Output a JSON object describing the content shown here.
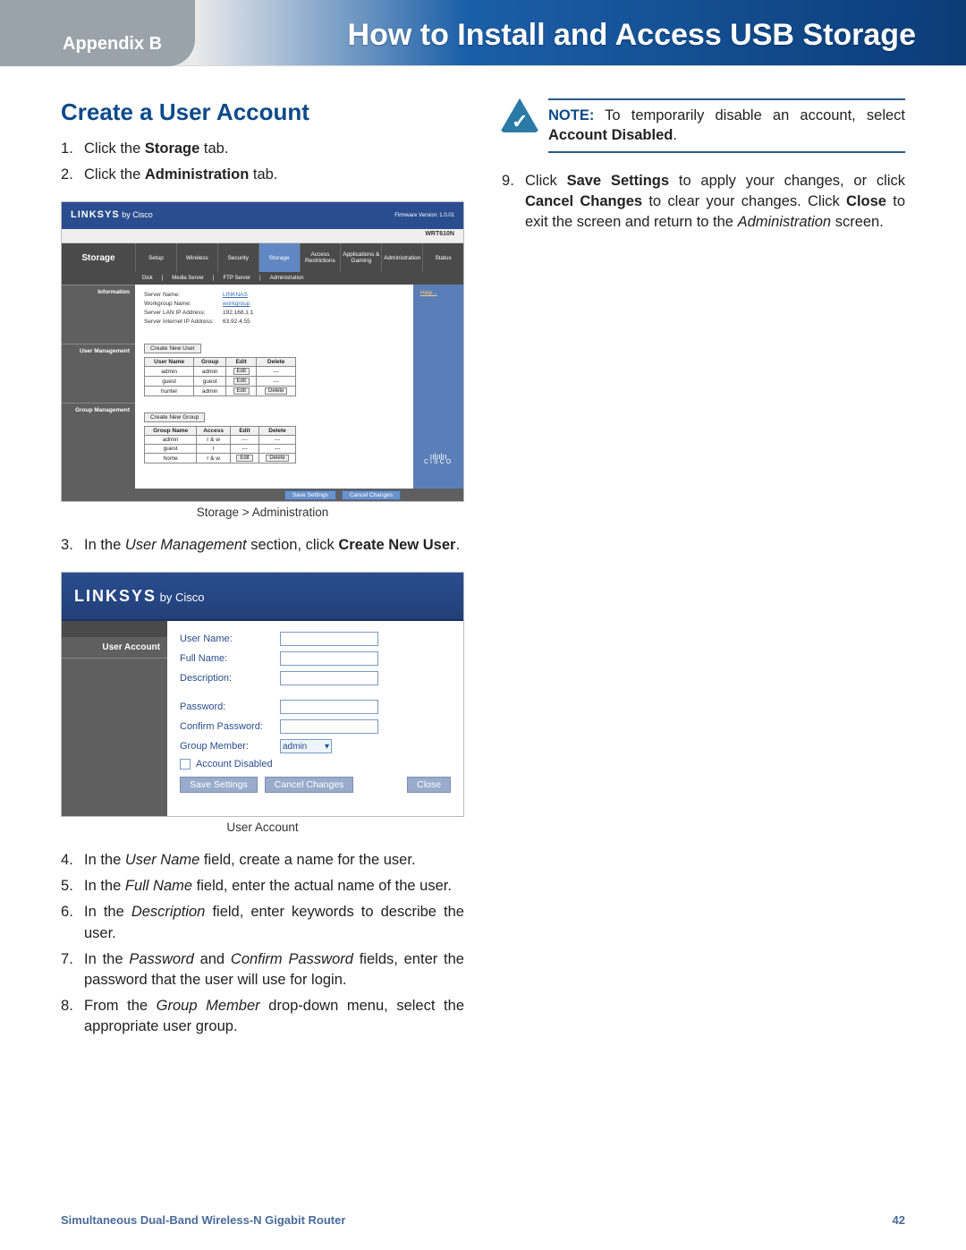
{
  "header": {
    "appendix": "Appendix B",
    "title": "How to Install and Access USB Storage"
  },
  "left": {
    "section_title": "Create a User Account",
    "step1_pre": "Click the ",
    "step1_bold": "Storage",
    "step1_post": " tab.",
    "step2_pre": "Click the ",
    "step2_bold": "Administration",
    "step2_post": " tab.",
    "fig1_caption": "Storage > Administration",
    "step3_pre": "In the ",
    "step3_it": "User Management",
    "step3_mid": " section, click ",
    "step3_bold": "Create New User",
    "step3_post": ".",
    "fig2_caption": "User Account",
    "step4_pre": "In the ",
    "step4_it": "User Name",
    "step4_post": " field, create a name for the user.",
    "step5_pre": "In the ",
    "step5_it": "Full Name",
    "step5_post": " field, enter the actual name of the user.",
    "step6_pre": "In the ",
    "step6_it": "Description",
    "step6_post": " field, enter keywords to describe the user.",
    "step7_pre": "In the ",
    "step7_it1": "Password",
    "step7_mid": " and ",
    "step7_it2": "Confirm Password",
    "step7_post": " fields, enter the password that the user will use for login.",
    "step8_pre": "From the ",
    "step8_it": "Group Member",
    "step8_post": " drop-down menu, select the appropriate user group."
  },
  "right": {
    "note_label": "NOTE:",
    "note_text_pre": " To temporarily disable an account, select ",
    "note_text_bold": "Account Disabled",
    "note_text_post": ".",
    "step9_pre": "Click ",
    "step9_b1": "Save Settings",
    "step9_mid1": " to apply your changes, or click ",
    "step9_b2": "Cancel Changes",
    "step9_mid2": " to clear your changes. Click ",
    "step9_b3": "Close",
    "step9_mid3": " to exit the screen and return to the ",
    "step9_it": "Administration",
    "step9_post": " screen."
  },
  "fig1": {
    "logo": "LINKSYS",
    "logo_by": " by Cisco",
    "firmware": "Firmware Version: 1.0.01",
    "model": "WRT610N",
    "side_storage": "Storage",
    "tabs": [
      "Setup",
      "Wireless",
      "Security",
      "Storage",
      "Access Restrictions",
      "Applications & Gaming",
      "Administration",
      "Status"
    ],
    "subnav": [
      "Disk",
      "Media Server",
      "FTP Server",
      "Administration"
    ],
    "side_info": "Information",
    "side_um": "User Management",
    "side_gm": "Group Management",
    "info_rows": [
      {
        "label": "Server Name:",
        "val": "LINKNAS",
        "link": true
      },
      {
        "label": "Workgroup Name:",
        "val": "workgroup",
        "link": true
      },
      {
        "label": "Server LAN IP Address:",
        "val": "192.168.1.1",
        "link": false
      },
      {
        "label": "Server Internet IP Address:",
        "val": "63.92.4.55",
        "link": false
      }
    ],
    "btn_new_user": "Create New User",
    "user_table": {
      "headers": [
        "User Name",
        "Group",
        "Edit",
        "Delete"
      ],
      "rows": [
        {
          "name": "admin",
          "group": "admin",
          "edit": "Edit",
          "del": "---"
        },
        {
          "name": "guest",
          "group": "guest",
          "edit": "Edit",
          "del": "---"
        },
        {
          "name": "hunter",
          "group": "admin",
          "edit": "Edit",
          "del": "Delete"
        }
      ]
    },
    "btn_new_group": "Create New Group",
    "group_table": {
      "headers": [
        "Group Name",
        "Access",
        "Edit",
        "Delete"
      ],
      "rows": [
        {
          "name": "admin",
          "access": "r & w",
          "edit": "---",
          "del": "---"
        },
        {
          "name": "guest",
          "access": "r",
          "edit": "---",
          "del": "---"
        },
        {
          "name": "home",
          "access": "r & w",
          "edit": "Edit",
          "del": "Delete"
        }
      ]
    },
    "help": "Help...",
    "cisco": "CISCO",
    "save": "Save Settings",
    "cancel": "Cancel Changes"
  },
  "fig2": {
    "logo": "LINKSYS",
    "logo_by": " by Cisco",
    "side_label": "User Account",
    "fields": {
      "username": "User Name:",
      "fullname": "Full Name:",
      "description": "Description:",
      "password": "Password:",
      "confirm": "Confirm Password:",
      "group": "Group Member:",
      "group_val": "admin",
      "disabled": "Account Disabled"
    },
    "btns": {
      "save": "Save Settings",
      "cancel": "Cancel Changes",
      "close": "Close"
    }
  },
  "footer": {
    "product": "Simultaneous Dual-Band Wireless-N Gigabit Router",
    "page": "42"
  }
}
